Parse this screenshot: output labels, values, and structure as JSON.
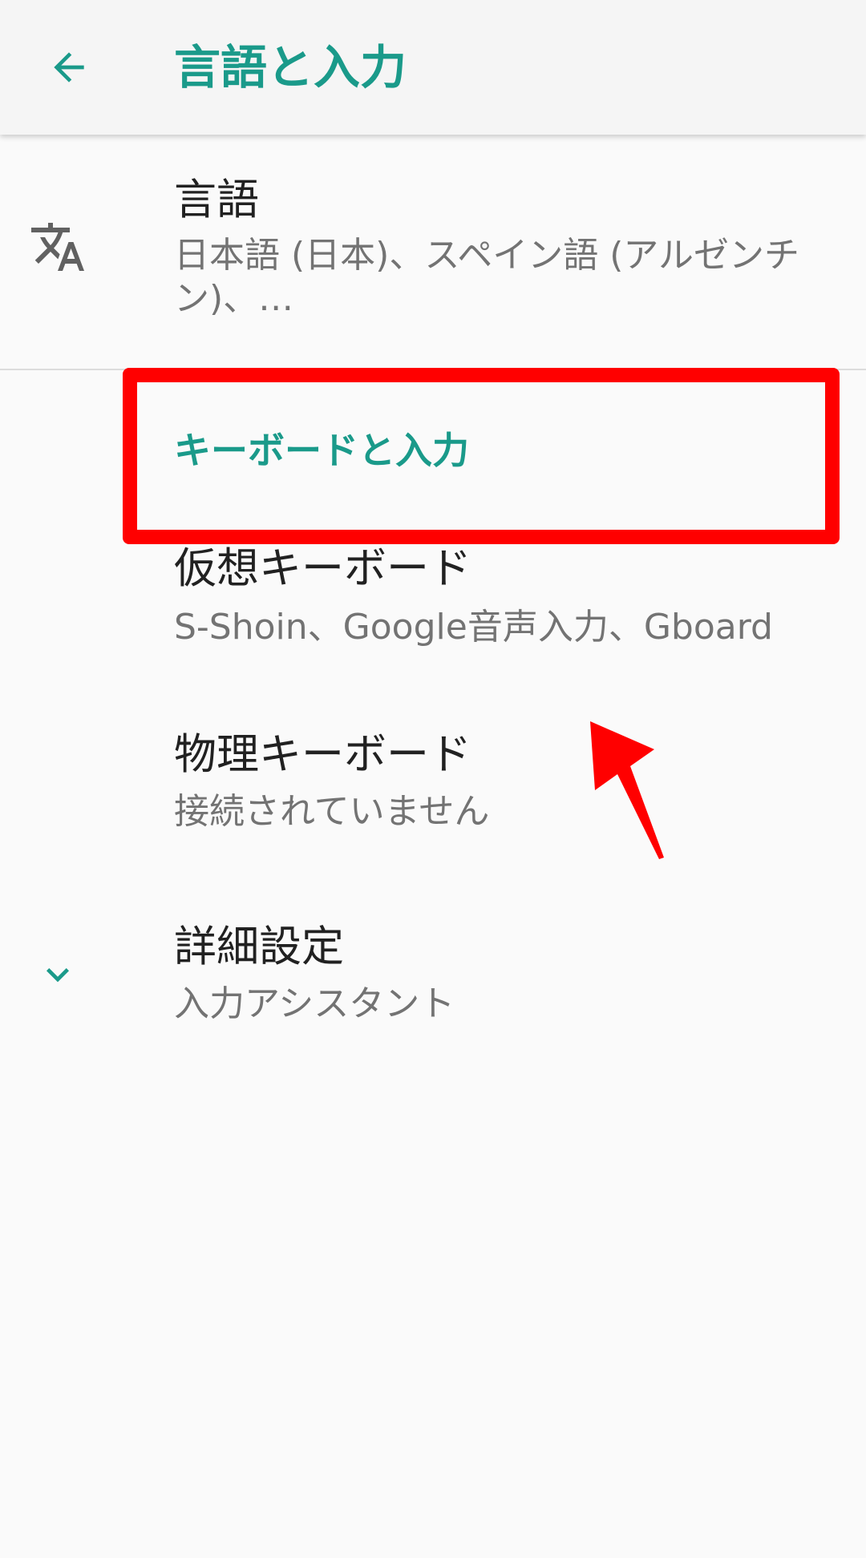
{
  "header": {
    "back_icon": "arrow-back-icon",
    "title": "言語と入力"
  },
  "language": {
    "icon": "translate-icon",
    "title": "言語",
    "summary": "日本語 (日本)、スペイン語 (アルゼンチン)、…"
  },
  "section": {
    "title": "キーボードと入力"
  },
  "virtual_keyboard": {
    "title": "仮想キーボード",
    "summary": "S-Shoin、Google音声入力、Gboard"
  },
  "physical_keyboard": {
    "title": "物理キーボード",
    "summary": "接続されていません"
  },
  "advanced": {
    "icon": "chevron-down-icon",
    "title": "詳細設定",
    "summary": "入力アシスタント"
  },
  "colors": {
    "accent": "#1a9a8a",
    "annotation": "#ff0000"
  }
}
